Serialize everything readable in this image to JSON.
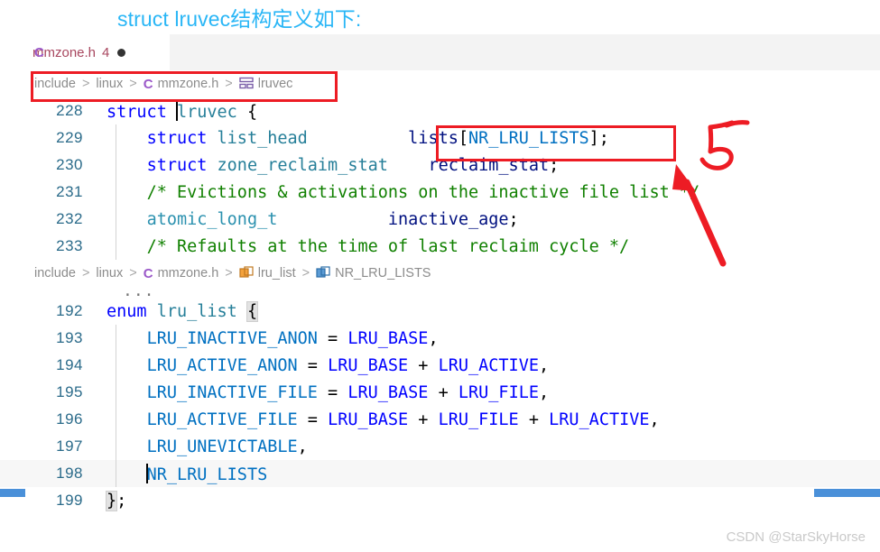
{
  "heading": {
    "text": "struct lruvec结构定义如下:",
    "color": "#29b6f6"
  },
  "tab": {
    "lang_icon": "C",
    "filename": "mmzone.h",
    "problem_count": "4",
    "dirty_indicator": "dirty-dot"
  },
  "breadcrumb_top": {
    "segments": [
      "include",
      "linux",
      "mmzone.h",
      "lruvec"
    ],
    "separator": ">",
    "file_icon": "C",
    "symbol_icon": "struct-icon"
  },
  "breadcrumb_mid": {
    "segments": [
      "include",
      "linux",
      "mmzone.h",
      "lru_list",
      "NR_LRU_LISTS"
    ],
    "separator": ">",
    "file_icon": "C",
    "enum_icon": "enum-icon",
    "enum_member_icon": "enum-member-icon"
  },
  "code_struct": {
    "fold_ellipsis": "...",
    "lines": [
      {
        "number": "228",
        "indent_guide": false,
        "highlighted": false,
        "tokens": [
          {
            "text": "struct ",
            "cls": "t-key"
          },
          {
            "text": "",
            "cls": "caret"
          },
          {
            "text": "lruvec ",
            "cls": "t-type"
          },
          {
            "text": "{",
            "cls": "t-punct"
          }
        ]
      },
      {
        "number": "229",
        "indent_guide": true,
        "highlighted": false,
        "tokens": [
          {
            "text": "    ",
            "cls": "t-punct"
          },
          {
            "text": "struct ",
            "cls": "t-key"
          },
          {
            "text": "list_head",
            "cls": "t-type"
          },
          {
            "text": "          ",
            "cls": "t-punct"
          },
          {
            "text": "lists",
            "cls": "t-var"
          },
          {
            "text": "[",
            "cls": "t-punct"
          },
          {
            "text": "NR_LRU_LISTS",
            "cls": "t-enum"
          },
          {
            "text": "];",
            "cls": "t-punct"
          }
        ]
      },
      {
        "number": "230",
        "indent_guide": true,
        "highlighted": false,
        "tokens": [
          {
            "text": "    ",
            "cls": "t-punct"
          },
          {
            "text": "struct ",
            "cls": "t-key"
          },
          {
            "text": "zone_reclaim_stat",
            "cls": "t-type"
          },
          {
            "text": "    ",
            "cls": "t-punct"
          },
          {
            "text": "reclaim_stat",
            "cls": "t-var"
          },
          {
            "text": ";",
            "cls": "t-punct"
          }
        ]
      },
      {
        "number": "231",
        "indent_guide": true,
        "highlighted": false,
        "tokens": [
          {
            "text": "    ",
            "cls": "t-punct"
          },
          {
            "text": "/* Evictions & activations on the inactive file list */",
            "cls": "t-comment"
          }
        ]
      },
      {
        "number": "232",
        "indent_guide": true,
        "highlighted": false,
        "tokens": [
          {
            "text": "    ",
            "cls": "t-punct"
          },
          {
            "text": "atomic_long_t",
            "cls": "t-typedef"
          },
          {
            "text": "           ",
            "cls": "t-punct"
          },
          {
            "text": "inactive_age",
            "cls": "t-var"
          },
          {
            "text": ";",
            "cls": "t-punct"
          }
        ]
      },
      {
        "number": "233",
        "indent_guide": true,
        "highlighted": false,
        "tokens": [
          {
            "text": "    ",
            "cls": "t-punct"
          },
          {
            "text": "/* Refaults at the time of last reclaim cycle */",
            "cls": "t-comment"
          }
        ]
      }
    ]
  },
  "code_enum": {
    "fold_ellipsis": "...",
    "lines": [
      {
        "number": "192",
        "indent_guide": false,
        "highlighted": false,
        "tokens": [
          {
            "text": "enum ",
            "cls": "t-key"
          },
          {
            "text": "lru_list ",
            "cls": "t-type"
          },
          {
            "text": "{",
            "cls": "brace-match t-punct"
          }
        ]
      },
      {
        "number": "193",
        "indent_guide": true,
        "highlighted": false,
        "tokens": [
          {
            "text": "    ",
            "cls": "t-punct"
          },
          {
            "text": "LRU_INACTIVE_ANON",
            "cls": "t-enum"
          },
          {
            "text": " = ",
            "cls": "t-punct"
          },
          {
            "text": "LRU_BASE",
            "cls": "t-const"
          },
          {
            "text": ",",
            "cls": "t-punct"
          }
        ]
      },
      {
        "number": "194",
        "indent_guide": true,
        "highlighted": false,
        "tokens": [
          {
            "text": "    ",
            "cls": "t-punct"
          },
          {
            "text": "LRU_ACTIVE_ANON",
            "cls": "t-enum"
          },
          {
            "text": " = ",
            "cls": "t-punct"
          },
          {
            "text": "LRU_BASE",
            "cls": "t-const"
          },
          {
            "text": " + ",
            "cls": "t-punct"
          },
          {
            "text": "LRU_ACTIVE",
            "cls": "t-const"
          },
          {
            "text": ",",
            "cls": "t-punct"
          }
        ]
      },
      {
        "number": "195",
        "indent_guide": true,
        "highlighted": false,
        "tokens": [
          {
            "text": "    ",
            "cls": "t-punct"
          },
          {
            "text": "LRU_INACTIVE_FILE",
            "cls": "t-enum"
          },
          {
            "text": " = ",
            "cls": "t-punct"
          },
          {
            "text": "LRU_BASE",
            "cls": "t-const"
          },
          {
            "text": " + ",
            "cls": "t-punct"
          },
          {
            "text": "LRU_FILE",
            "cls": "t-const"
          },
          {
            "text": ",",
            "cls": "t-punct"
          }
        ]
      },
      {
        "number": "196",
        "indent_guide": true,
        "highlighted": false,
        "tokens": [
          {
            "text": "    ",
            "cls": "t-punct"
          },
          {
            "text": "LRU_ACTIVE_FILE",
            "cls": "t-enum"
          },
          {
            "text": " = ",
            "cls": "t-punct"
          },
          {
            "text": "LRU_BASE",
            "cls": "t-const"
          },
          {
            "text": " + ",
            "cls": "t-punct"
          },
          {
            "text": "LRU_FILE",
            "cls": "t-const"
          },
          {
            "text": " + ",
            "cls": "t-punct"
          },
          {
            "text": "LRU_ACTIVE",
            "cls": "t-const"
          },
          {
            "text": ",",
            "cls": "t-punct"
          }
        ]
      },
      {
        "number": "197",
        "indent_guide": true,
        "highlighted": false,
        "tokens": [
          {
            "text": "    ",
            "cls": "t-punct"
          },
          {
            "text": "LRU_UNEVICTABLE",
            "cls": "t-enum"
          },
          {
            "text": ",",
            "cls": "t-punct"
          }
        ]
      },
      {
        "number": "198",
        "indent_guide": true,
        "highlighted": true,
        "tokens": [
          {
            "text": "    ",
            "cls": "t-punct"
          },
          {
            "text": "",
            "cls": "caret"
          },
          {
            "text": "NR_LRU_LISTS",
            "cls": "t-enum"
          }
        ]
      },
      {
        "number": "199",
        "indent_guide": false,
        "highlighted": false,
        "tokens": [
          {
            "text": "}",
            "cls": "brace-match t-punct"
          },
          {
            "text": ";",
            "cls": "t-punct"
          }
        ]
      }
    ]
  },
  "annotations": {
    "color": "#ed1c24",
    "number_mark": "5",
    "breadcrumb_box": "highlight-box-breadcrumb",
    "lists_box": "highlight-box-lists",
    "arrow": "pointer-arrow"
  },
  "edge_bars": {
    "color": "#4a90d9"
  },
  "watermark": {
    "text": "CSDN @StarSkyHorse"
  }
}
